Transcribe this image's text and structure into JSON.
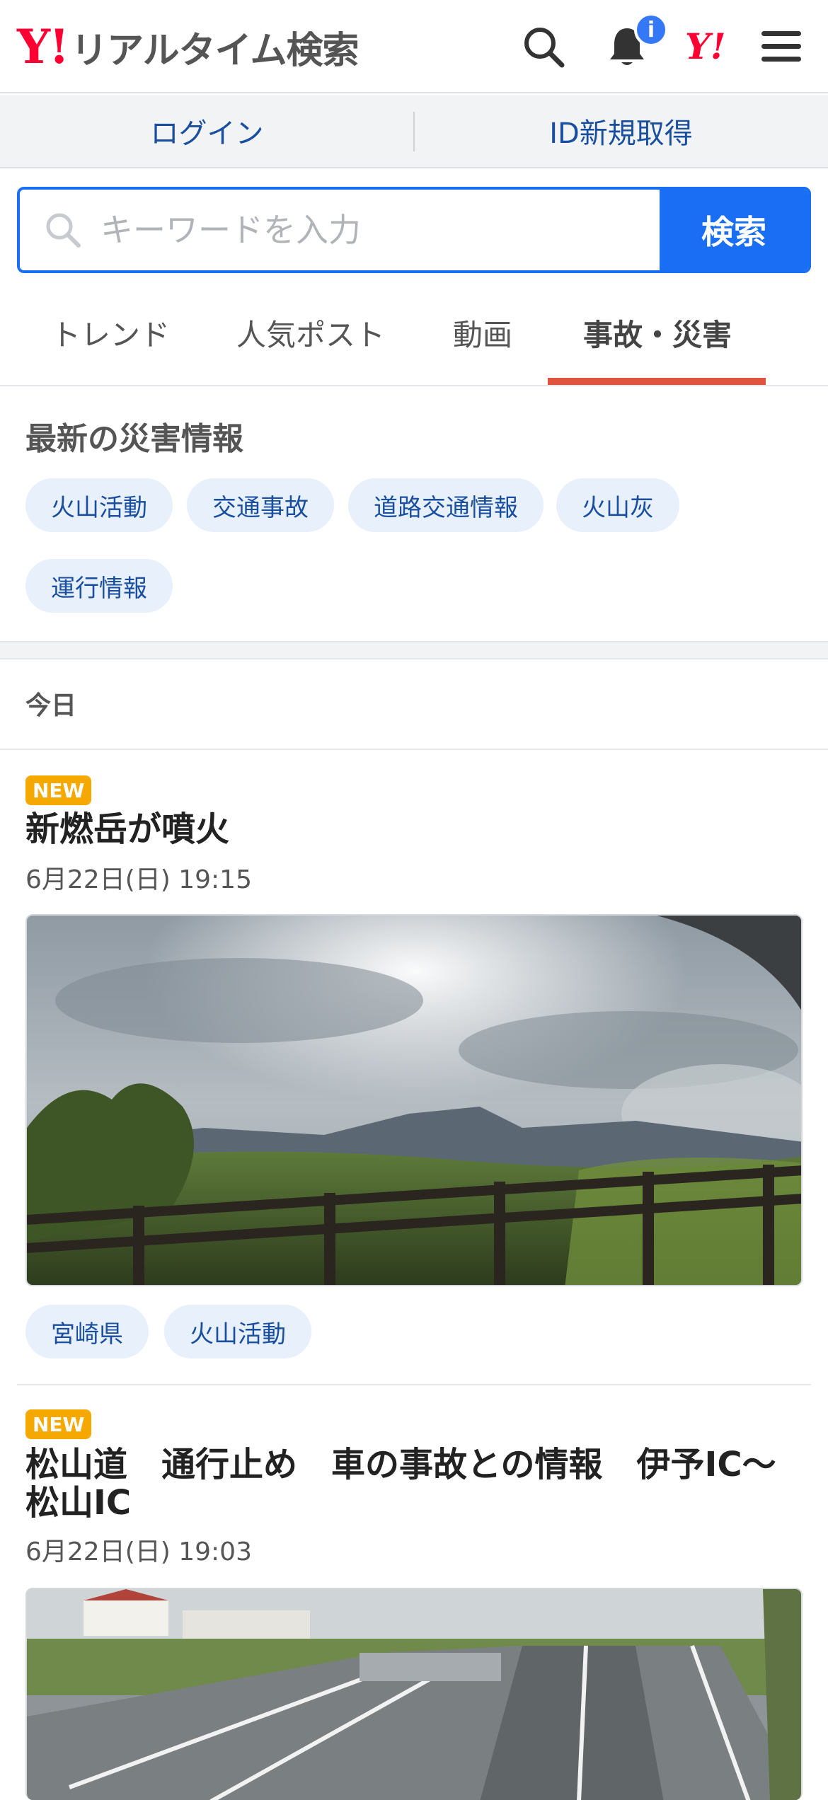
{
  "header": {
    "logo_mark": "Y!",
    "logo_text": "リアルタイム検索",
    "notification_count": "i",
    "yahoo_mark": "Y!"
  },
  "login_bar": {
    "login_label": "ログイン",
    "register_label": "ID新規取得"
  },
  "search": {
    "placeholder": "キーワードを入力",
    "button_label": "検索"
  },
  "tabs": [
    {
      "label": "トレンド"
    },
    {
      "label": "人気ポスト"
    },
    {
      "label": "動画"
    },
    {
      "label": "事故・災害"
    }
  ],
  "active_tab": "事故・災害",
  "disaster": {
    "title": "最新の災害情報",
    "chips": [
      "火山活動",
      "交通事故",
      "道路交通情報",
      "火山灰",
      "運行情報"
    ]
  },
  "today_label": "今日",
  "news": [
    {
      "badge": "NEW",
      "title": "新燃岳が噴火",
      "time": "6月22日(日) 19:15",
      "tags": [
        "宮崎県",
        "火山活動"
      ]
    },
    {
      "badge": "NEW",
      "title": "松山道　通行止め　車の事故との情報　伊予IC〜松山IC",
      "time": "6月22日(日) 19:03"
    }
  ],
  "colors": {
    "brand_red": "#ff0033",
    "accent_blue": "#1a6ef4",
    "tab_underline": "#e0533f",
    "new_badge": "#f5a800"
  }
}
